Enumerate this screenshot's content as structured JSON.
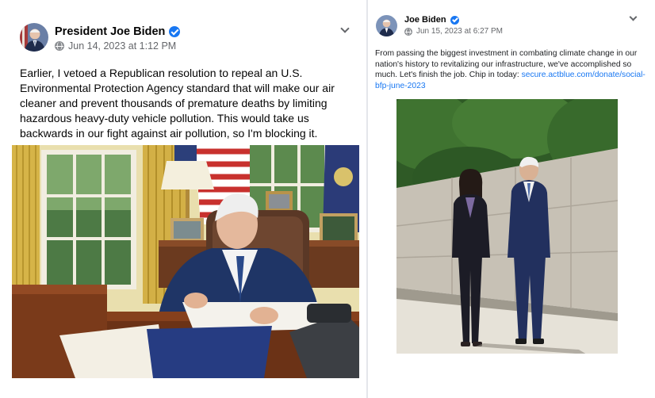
{
  "left_post": {
    "author": "President Joe Biden",
    "timestamp": "Jun 14, 2023 at 1:12 PM",
    "text": "Earlier, I vetoed a Republican resolution to repeal an U.S. Environmental Protection Agency standard that will make our air cleaner and prevent thousands of premature deaths by limiting hazardous heavy-duty vehicle pollution. This would take us backwards in our fight against air pollution, so I'm blocking it."
  },
  "right_post": {
    "author": "Joe Biden",
    "timestamp": "Jun 15, 2023 at 6:27 PM",
    "text": "From passing the biggest investment in combating climate change in our nation's history to revitalizing our infrastructure, we've accomplished so much. Let's finish the job. Chip in today: ",
    "link": "secure.actblue.com/donate/social-bfp-june-2023"
  },
  "colors": {
    "verified": "#1877f2",
    "link": "#1877f2",
    "secondary_text": "#65676b"
  },
  "icons": [
    "verified-badge-icon",
    "globe-icon",
    "chevron-down-icon"
  ]
}
